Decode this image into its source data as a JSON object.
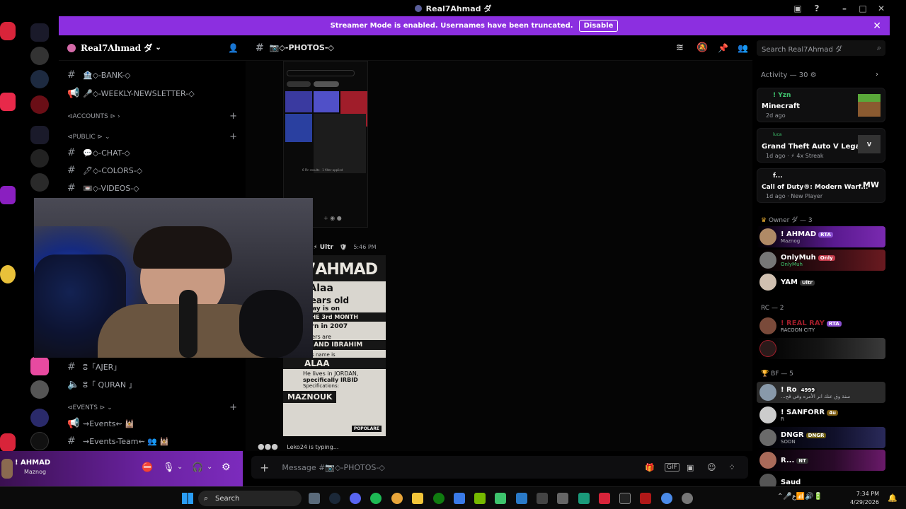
{
  "window": {
    "title": "Real7Ahmad ダ"
  },
  "streamer_banner": {
    "text": "Streamer Mode is enabled. Usernames have been truncated.",
    "disable_label": "Disable"
  },
  "server": {
    "name": "Real7Ahmad ダ"
  },
  "channels": {
    "items_top": [
      {
        "label": "🏦◇-BANK-◇"
      },
      {
        "label": "🎤◇-WEEKLY-NEWSLETTER-◇"
      }
    ],
    "cat_accounts": "⊲ACCOUNTS ⊳ ›",
    "cat_public": "⊲PUBLIC ⊳ ⌄",
    "public_items": [
      {
        "label": "💬◇-CHAT-◇"
      },
      {
        "label": "🖊◇-COLORS-◇"
      },
      {
        "label": "📼◇-VIDEOS-◇"
      }
    ],
    "ajer": "ⵓ「AJER」",
    "quran": "ⵓ「 QURAN 」",
    "cat_events": "⊲EVENTS ⊳ ⌄",
    "events": "⇝Events⇜ 🕍",
    "events_team": "⇝Events-Team⇜ 👥 🕍"
  },
  "user_panel": {
    "name": "! AHMAD",
    "sub": "Maznog"
  },
  "chat": {
    "channel_name": "📷◇-PHOTOS-◇",
    "msg_author": "Ultr",
    "msg_time": "5:46 PM",
    "typing": "Leko24 is typing...",
    "composer_placeholder": "Message #📷◇-PHOTOS-◇",
    "phone_caption": "6 Pin results · 1 filter applied",
    "poster": {
      "lines": [
        "AL7AHMAD",
        "ned Alaa",
        "18 years old",
        "birthday is on",
        "TH OF THE 3rd MONTH",
        "was born in 2007",
        "His brothers are",
        "YAMAN AND IBRAHIM",
        "His father's name is",
        "ALAA",
        "He lives in JORDAN,",
        "specifically IRBID",
        "Specifications:",
        "MAZNOUK",
        "POPOLARE"
      ]
    }
  },
  "search": {
    "placeholder": "Search Real7Ahmad ダ"
  },
  "members": {
    "activity_header": "Activity — 30",
    "activities": [
      {
        "user": "! Yzn",
        "game": "Minecraft",
        "meta": "2d ago"
      },
      {
        "user": "luca",
        "game": "Grand Theft Auto V Legacy",
        "meta": "1d ago · ⚡ 4x Streak"
      },
      {
        "user": "f...",
        "game": "Call of Duty®: Modern Warf...",
        "meta": "1d ago · New Player"
      }
    ],
    "owner_header": "Owner ダ — 3",
    "owners": [
      {
        "name": "! AHMAD",
        "badge": "RTA",
        "sub": "Maznog"
      },
      {
        "name": "OnlyMuh",
        "badge": "Only",
        "sub": "OnlyMuh"
      },
      {
        "name": "YAM",
        "badge": "Ultr",
        "sub": ""
      }
    ],
    "rc_header": "RC — 2",
    "rc": [
      {
        "name": "! REAL RAY",
        "badge": "RTA",
        "sub": "RACOON CITY"
      },
      {
        "name": "",
        "badge": "",
        "sub": ""
      }
    ],
    "bf_header": "BF — 5",
    "bf": [
      {
        "name": "! Ro",
        "badge": "4999",
        "sub": "...سنة وق عنك انر الأمره وفي قح"
      },
      {
        "name": "! SANFORR",
        "badge": "4u",
        "sub": "R"
      },
      {
        "name": "DNGR",
        "badge": "DNGR",
        "sub": "SOON"
      },
      {
        "name": "R...",
        "badge": "NT",
        "sub": ""
      },
      {
        "name": "Saud",
        "badge": "",
        "sub": ""
      }
    ]
  },
  "taskbar": {
    "search_label": "Search",
    "time": "7:34 PM",
    "date": "4/29/2026"
  },
  "colors": {
    "accent": "#8c2fe0",
    "panel": "#000000"
  }
}
